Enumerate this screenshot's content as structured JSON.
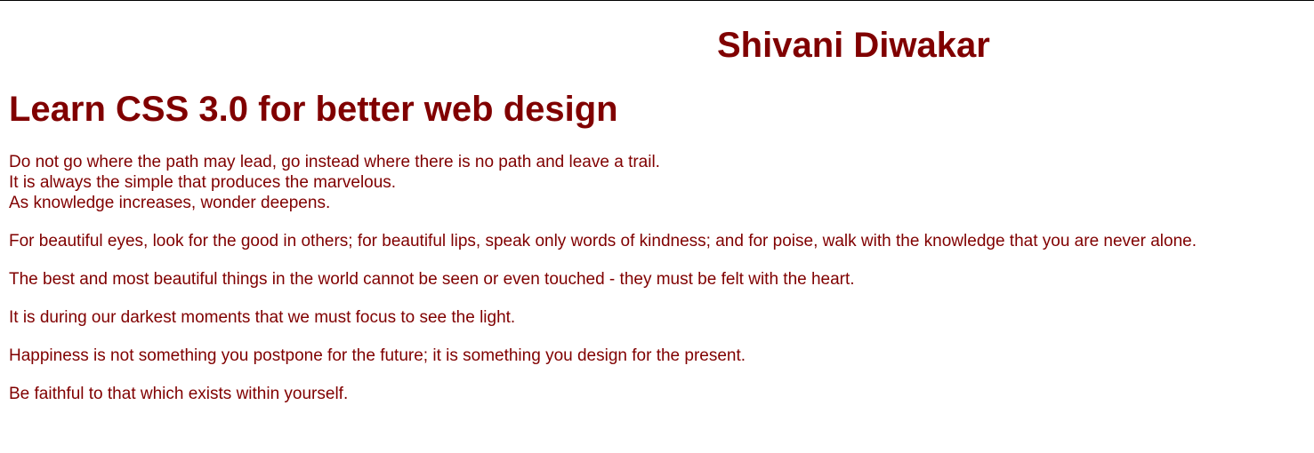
{
  "header": {
    "author": "Shivani Diwakar"
  },
  "main": {
    "title": "Learn CSS 3.0 for better web design",
    "first_paragraph": {
      "lines": [
        "Do not go where the path may lead, go instead where there is no path and leave a trail.",
        "It is always the simple that produces the marvelous.",
        "As knowledge increases, wonder deepens."
      ]
    },
    "paragraphs": [
      "For beautiful eyes, look for the good in others; for beautiful lips, speak only words of kindness; and for poise, walk with the knowledge that you are never alone.",
      "The best and most beautiful things in the world cannot be seen or even touched - they must be felt with the heart.",
      "It is during our darkest moments that we must focus to see the light.",
      "Happiness is not something you postpone for the future; it is something you design for the present.",
      "Be faithful to that which exists within yourself."
    ]
  },
  "colors": {
    "text": "#800000",
    "background": "#ffffff"
  }
}
